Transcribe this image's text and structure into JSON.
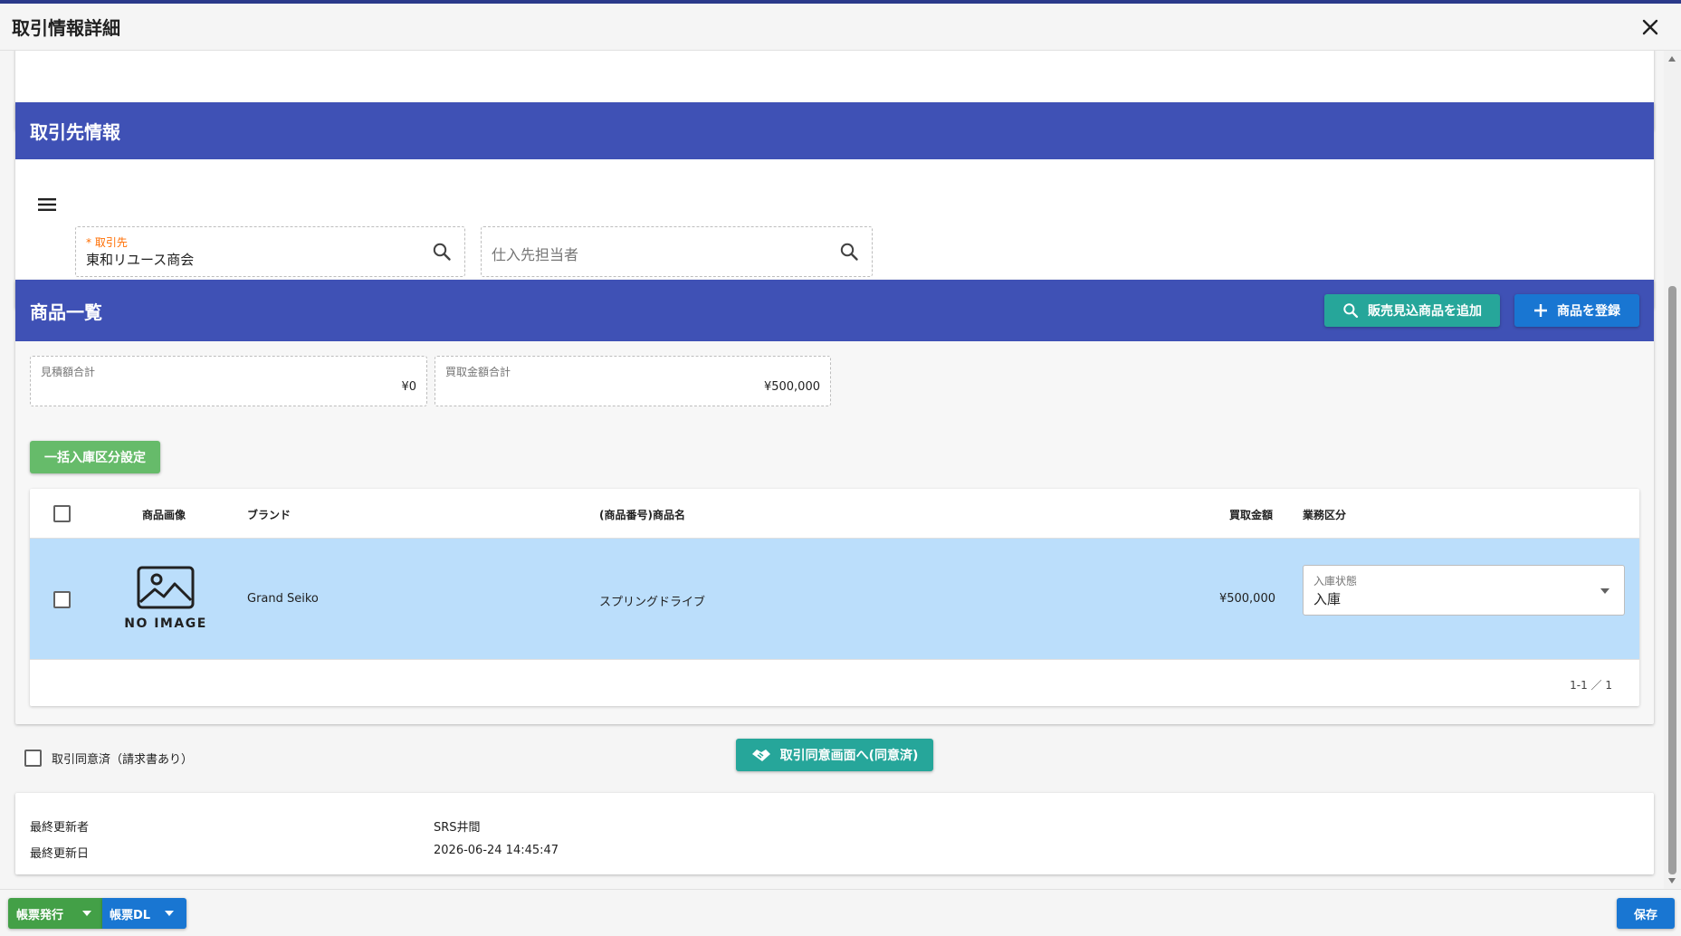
{
  "window": {
    "title": "取引情報詳細"
  },
  "partner": {
    "header": "取引先情報",
    "partner_field": {
      "required_mark": "*",
      "label": "取引先",
      "value": "東和リユース商会"
    },
    "supplier_field": {
      "placeholder": "仕入先担当者"
    }
  },
  "products": {
    "header": "商品一覧",
    "add_sales_button": "販売見込商品を追加",
    "register_button": "商品を登録",
    "estimate_total": {
      "label": "見積額合計",
      "value": "¥0"
    },
    "purchase_total": {
      "label": "買取金額合計",
      "value": "¥500,000"
    },
    "bulk_button": "一括入庫区分設定",
    "table": {
      "columns": [
        "商品画像",
        "ブランド",
        "(商品番号)商品名",
        "買取金額",
        "業務区分"
      ],
      "rows": [
        {
          "image_text": "NO IMAGE",
          "brand": "Grand Seiko",
          "name": "スプリングドライブ",
          "price": "¥500,000",
          "status_label": "入庫状態",
          "status_value": "入庫"
        }
      ],
      "pagination": "1-1 ／ 1"
    }
  },
  "agreement": {
    "checkbox_label": "取引同意済（請求書あり）",
    "button": "取引同意画面へ(同意済)"
  },
  "meta": {
    "updated_by_label": "最終更新者",
    "updated_by_value": "SRS井間",
    "updated_at_label": "最終更新日",
    "updated_at_value": "2026-06-24 14:45:47"
  },
  "footer": {
    "issue_button": "帳票発行",
    "download_button": "帳票DL",
    "save_button": "保存"
  },
  "colors": {
    "header_blue": "#3f51b5",
    "teal": "#26a69a",
    "primary_blue": "#1976d2",
    "green": "#43a047",
    "light_green": "#66bb6a",
    "selected_row": "#bbdefb",
    "required_orange": "#ff6d00"
  }
}
